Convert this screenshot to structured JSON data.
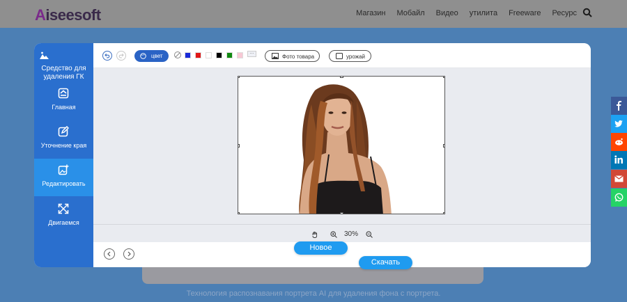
{
  "header": {
    "logo_prefix": "A",
    "logo_rest": "iseesoft",
    "nav": [
      "Магазин",
      "Мобайл",
      "Видео",
      "утилита",
      "Freeware",
      "Ресурс"
    ]
  },
  "sidebar": {
    "title": "Средство для удаления ГК",
    "items": [
      {
        "label": "Главная",
        "icon": "home-icon",
        "active": false
      },
      {
        "label": "Уточнение края",
        "icon": "edit-icon",
        "active": false
      },
      {
        "label": "Редактировать",
        "icon": "image-edit-icon",
        "active": true
      },
      {
        "label": "Двигаемся",
        "icon": "move-icon",
        "active": false
      }
    ]
  },
  "toolbar": {
    "color_label": "цвет",
    "product_photo_label": "Фото товара",
    "crop_label": "урожай",
    "swatches": [
      "#1a2ad8",
      "#e01818",
      "#ffffff",
      "#000000",
      "#118a11",
      "#f7c8d4"
    ],
    "more_label": "..."
  },
  "zoom": {
    "value": "30%"
  },
  "footer": {
    "new_label": "Новое",
    "download_label": "Скачать"
  },
  "background": {
    "tagline": "Технология распознавания портрета AI для удаления фона с портрета."
  },
  "social": [
    {
      "icon": "facebook-icon",
      "color": "#3b5998"
    },
    {
      "icon": "twitter-icon",
      "color": "#1da1f2"
    },
    {
      "icon": "reddit-icon",
      "color": "#ff4500"
    },
    {
      "icon": "linkedin-icon",
      "color": "#0077b5"
    },
    {
      "icon": "gmail-icon",
      "color": "#d14836"
    },
    {
      "icon": "whatsapp-icon",
      "color": "#25d366"
    }
  ]
}
